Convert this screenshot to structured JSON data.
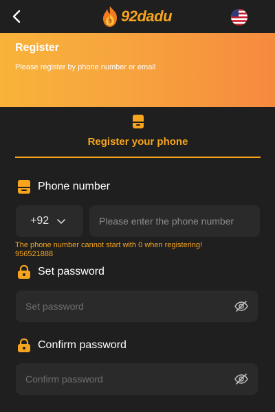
{
  "header": {
    "logo_text": "92dadu",
    "back_icon": "chevron-left-icon",
    "flag_icon": "us-flag-icon"
  },
  "banner": {
    "title": "Register",
    "subtitle": "Please register by phone number or email"
  },
  "tab": {
    "label": "Register your phone",
    "icon": "phone-icon"
  },
  "phone": {
    "label": "Phone number",
    "country_code": "+92",
    "placeholder": "Please enter the phone number",
    "error_line1": "The phone number cannot start with 0 when registering!",
    "error_line2": "956521888"
  },
  "password": {
    "label": "Set password",
    "placeholder": "Set password"
  },
  "confirm": {
    "label": "Confirm password",
    "placeholder": "Confirm password"
  },
  "colors": {
    "accent": "#f7a51e",
    "background": "#1f1f1f",
    "field": "#2a2a2a"
  }
}
